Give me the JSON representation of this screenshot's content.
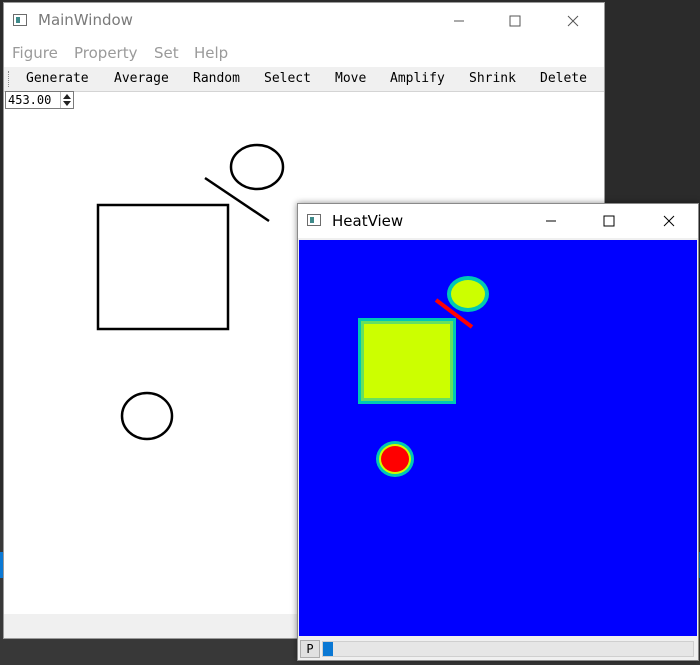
{
  "main_window": {
    "title": "MainWindow",
    "controls": {
      "minimize": "—",
      "maximize": "☐",
      "close": "✕"
    },
    "menu": [
      "Figure",
      "Property",
      "Set",
      "Help"
    ],
    "toolbar": [
      "Generate",
      "Average",
      "Random",
      "Select",
      "Move",
      "Amplify",
      "Shrink",
      "Delete"
    ],
    "spinbox_value": "453.00"
  },
  "heat_window": {
    "title": "HeatView",
    "controls": {
      "minimize": "—",
      "maximize": "☐",
      "close": "✕"
    },
    "p_button_label": "P"
  },
  "colors": {
    "heat_background": "#0000ff",
    "heat_high": "#ff0000",
    "heat_mid": "#ccff00",
    "heat_edge": "#00c8b4",
    "accent": "#0a78d4"
  },
  "icons": [
    "app-window-icon",
    "minimize-icon",
    "maximize-icon",
    "close-icon",
    "spin-up-icon",
    "spin-down-icon"
  ]
}
